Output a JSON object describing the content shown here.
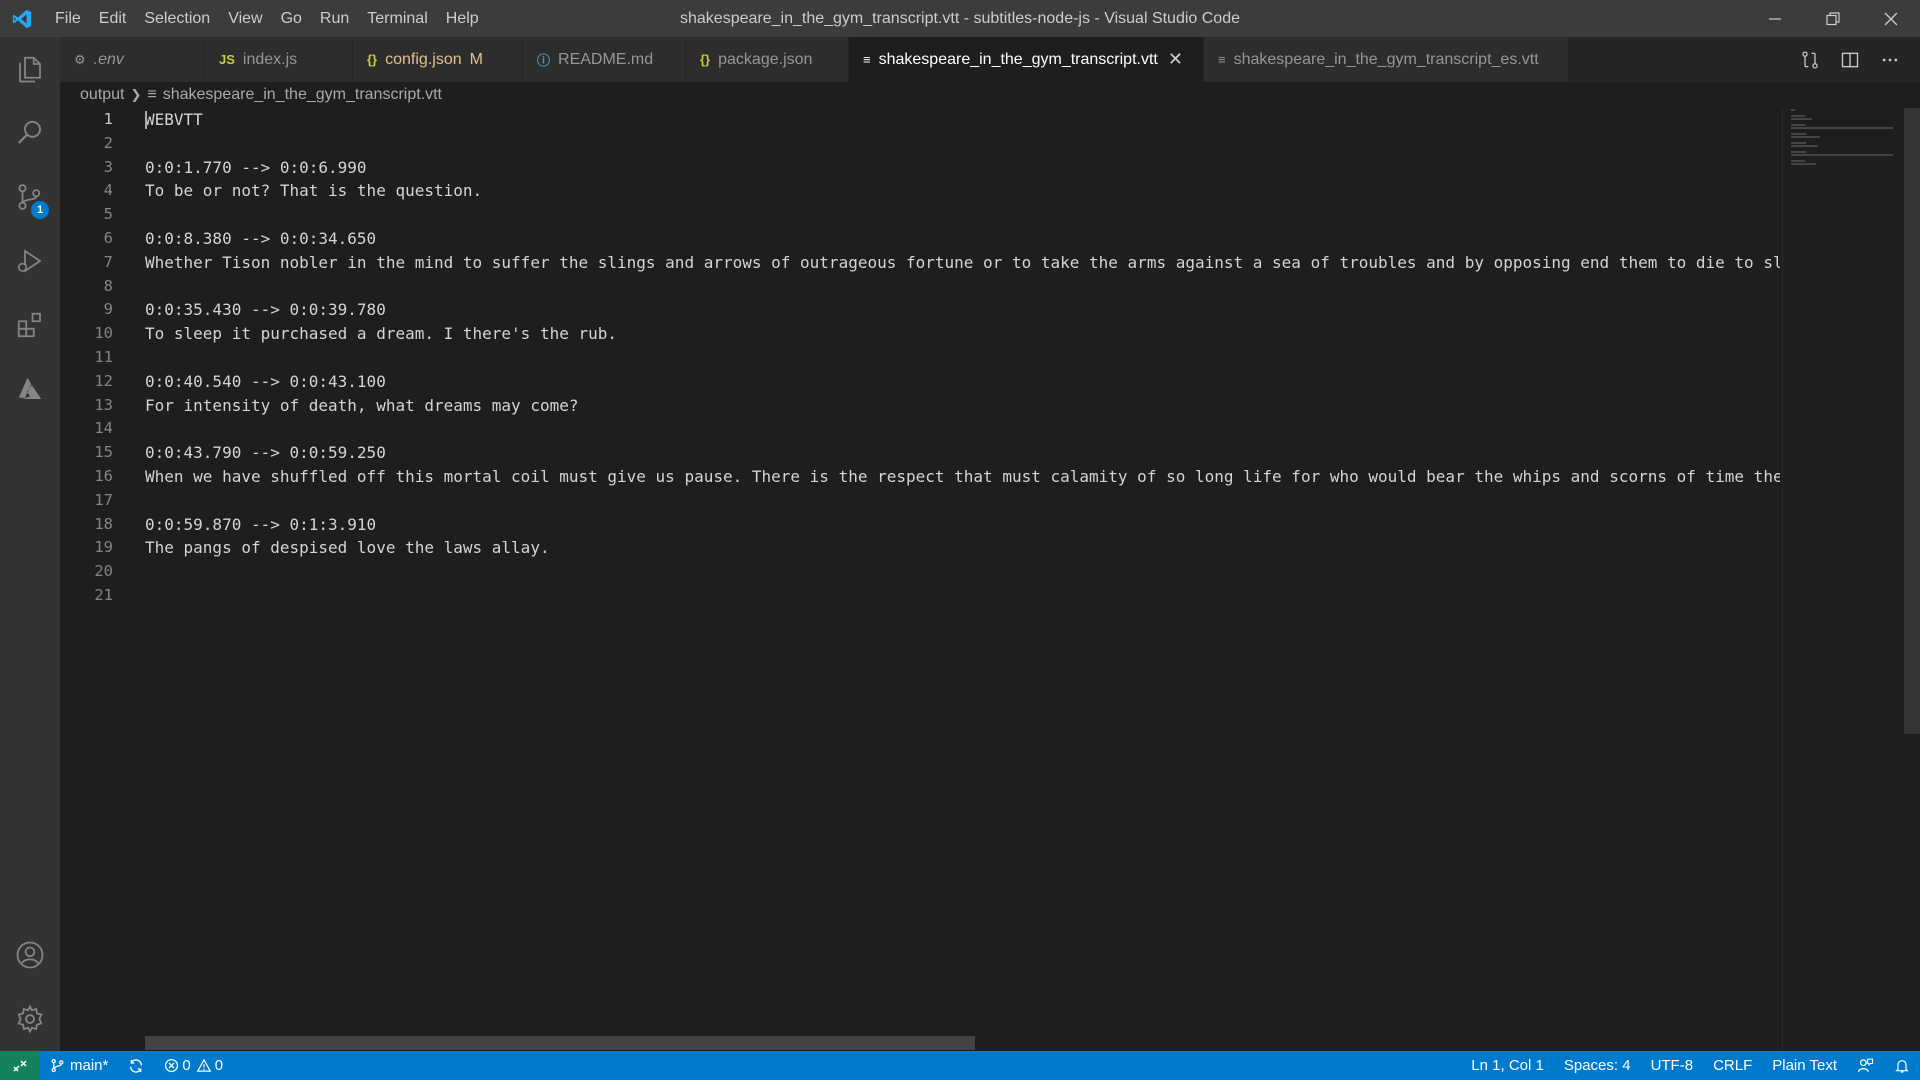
{
  "window": {
    "title": "shakespeare_in_the_gym_transcript.vtt - subtitles-node-js - Visual Studio Code"
  },
  "menu": [
    "File",
    "Edit",
    "Selection",
    "View",
    "Go",
    "Run",
    "Terminal",
    "Help"
  ],
  "activity_bar": {
    "items": [
      "explorer-icon",
      "search-icon",
      "source-control-icon",
      "run-debug-icon",
      "extensions-icon",
      "azure-icon"
    ],
    "source_control_badge": "1",
    "bottom_items": [
      "account-icon",
      "manage-gear-icon"
    ]
  },
  "tabs": [
    {
      "icon": "⚙",
      "label": ".env",
      "italic": true,
      "color": "#969696"
    },
    {
      "icon": "JS",
      "label": "index.js",
      "icon_color": "#cbcb41"
    },
    {
      "icon": "{}",
      "label": "config.json",
      "modified": "M",
      "icon_color": "#cbcb41",
      "label_color": "#e2c08d"
    },
    {
      "icon": "ⓘ",
      "label": "README.md",
      "icon_color": "#519aba"
    },
    {
      "icon": "{}",
      "label": "package.json",
      "icon_color": "#cbcb41"
    },
    {
      "icon": "≡",
      "label": "shakespeare_in_the_gym_transcript.vtt",
      "active": true,
      "close": "✕"
    },
    {
      "icon": "≡",
      "label": "shakespeare_in_the_gym_transcript_es.vtt"
    }
  ],
  "breadcrumb": {
    "folder": "output",
    "file": "shakespeare_in_the_gym_transcript.vtt"
  },
  "editor": {
    "current_line": 1,
    "lines": [
      "WEBVTT",
      "",
      "0:0:1.770 --> 0:0:6.990",
      "To be or not? That is the question.",
      "",
      "0:0:8.380 --> 0:0:34.650",
      "Whether Tison nobler in the mind to suffer the slings and arrows of outrageous fortune or to take the arms against a sea of troubles and by opposing end them to die to sl",
      "",
      "0:0:35.430 --> 0:0:39.780",
      "To sleep it purchased a dream. I there's the rub.",
      "",
      "0:0:40.540 --> 0:0:43.100",
      "For intensity of death, what dreams may come?",
      "",
      "0:0:43.790 --> 0:0:59.250",
      "When we have shuffled off this mortal coil must give us pause. There is the respect that must calamity of so long life for who would bear the whips and scorns of time the",
      "",
      "0:0:59.870 --> 0:1:3.910",
      "The pangs of despised love the laws allay.",
      "",
      ""
    ]
  },
  "status_bar": {
    "branch": "main*",
    "errors": "0",
    "warnings": "0",
    "position": "Ln 1, Col 1",
    "spaces": "Spaces: 4",
    "encoding": "UTF-8",
    "eol": "CRLF",
    "language": "Plain Text"
  },
  "colors": {
    "accent": "#007acc",
    "remote": "#16825d",
    "modified": "#e2c08d"
  }
}
